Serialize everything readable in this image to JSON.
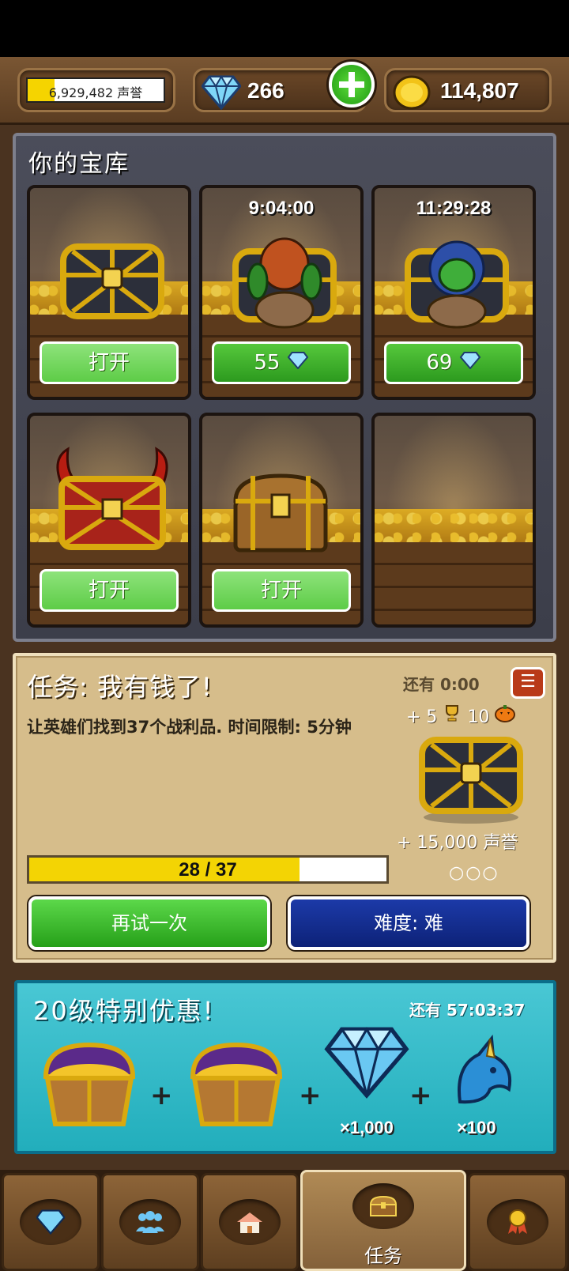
{
  "topbar": {
    "reputation": {
      "text": "6,929,482 声誉",
      "fill_fraction": 0.2
    },
    "gems": "266",
    "gold": "114,807"
  },
  "vault": {
    "title": "你的宝库",
    "slots": [
      {
        "timer": "",
        "button": "打开",
        "button_type": "open",
        "chest": "gold-lattice-chest"
      },
      {
        "timer": "9:04:00",
        "button": "55",
        "button_type": "gems",
        "chest": "goblin-chest"
      },
      {
        "timer": "11:29:28",
        "button": "69",
        "button_type": "gems",
        "chest": "hooded-goblin-chest"
      },
      {
        "timer": "",
        "button": "打开",
        "button_type": "open",
        "chest": "horned-red-chest"
      },
      {
        "timer": "",
        "button": "打开",
        "button_type": "open",
        "chest": "wooden-chest"
      },
      {
        "timer": "",
        "button": "",
        "button_type": "empty",
        "chest": ""
      }
    ]
  },
  "quest": {
    "title": "任务: 我有钱了!",
    "description": "让英雄们找到37个战利品. 时间限制: 5分钟",
    "time_left": "还有 0:00",
    "reward_trophies": "+ 5",
    "reward_pumpkins": "10",
    "reward_reputation": "+ 15,000 声誉",
    "stars": "○○○",
    "progress_text": "28 / 37",
    "progress_current": 28,
    "progress_total": 37,
    "retry_label": "再试一次",
    "difficulty_label": "难度: 难"
  },
  "offer": {
    "title": "20级特别优惠!",
    "time_left": "还有 57:03:37",
    "gem_qty": "×1,000",
    "unicorn_qty": "×100"
  },
  "nav": {
    "items": [
      {
        "name": "shop",
        "icon": "gem-icon",
        "label": ""
      },
      {
        "name": "heroes",
        "icon": "people-icon",
        "label": ""
      },
      {
        "name": "town",
        "icon": "house-icon",
        "label": ""
      },
      {
        "name": "quests",
        "icon": "chest-icon",
        "label": "任务"
      },
      {
        "name": "achievements",
        "icon": "medal-icon",
        "label": ""
      }
    ]
  },
  "colors": {
    "green_button": "#5cd84a",
    "blue_button": "#0d2278",
    "progress_yellow": "#f3d404",
    "offer_teal": "#22aebc"
  }
}
